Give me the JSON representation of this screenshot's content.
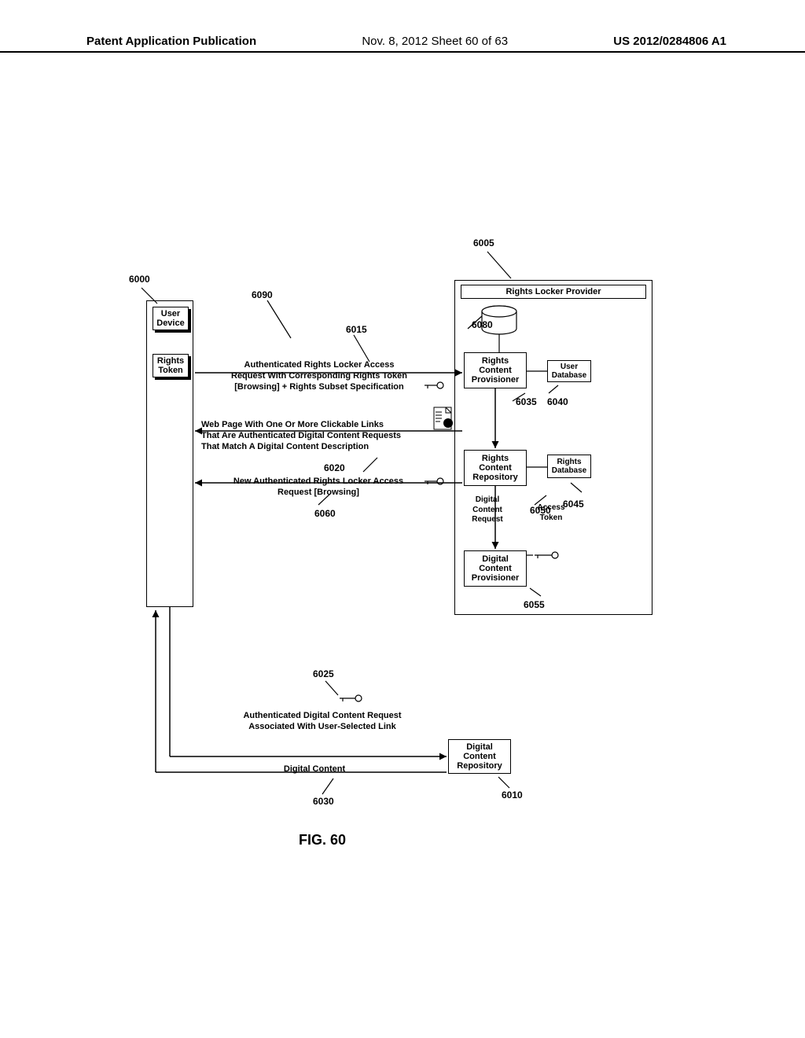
{
  "header": {
    "left": "Patent Application Publication",
    "mid": "Nov. 8, 2012  Sheet 60 of 63",
    "right": "US 2012/0284806 A1"
  },
  "refs": {
    "r6000": "6000",
    "r6005": "6005",
    "r6010": "6010",
    "r6015": "6015",
    "r6020": "6020",
    "r6025": "6025",
    "r6030": "6030",
    "r6035": "6035",
    "r6040": "6040",
    "r6045": "6045",
    "r6050": "6050",
    "r6055": "6055",
    "r6060": "6060",
    "r6080": "6080",
    "r6090": "6090"
  },
  "boxes": {
    "user_device": "User\nDevice",
    "rights_token": "Rights\nToken",
    "rights_locker_provider": "Rights Locker Provider",
    "rights_content_provisioner": "Rights\nContent\nProvisioner",
    "user_database": "User\nDatabase",
    "rights_content_repository": "Rights\nContent\nRepository",
    "rights_database": "Rights\nDatabase",
    "digital_content_provisioner": "Digital\nContent\nProvisioner",
    "digital_content_repository": "Digital\nContent\nRepository"
  },
  "labels": {
    "msg_6015": "Authenticated Rights Locker Access\nRequest With Corresponding Rights Token\n[Browsing] + Rights Subset Specification",
    "msg_6020": "Web Page With One Or More Clickable Links\nThat Are Authenticated Digital Content Requests\nThat Match A Digital Content Description",
    "msg_6060": "New Authenticated Rights Locker Access\nRequest [Browsing]",
    "msg_6025": "Authenticated Digital Content Request\nAssociated With User-Selected Link",
    "msg_6030": "Digital Content",
    "digital_content_request": "Digital\nContent\nRequest",
    "access_token": "Access\nToken"
  },
  "figure": "FIG. 60"
}
